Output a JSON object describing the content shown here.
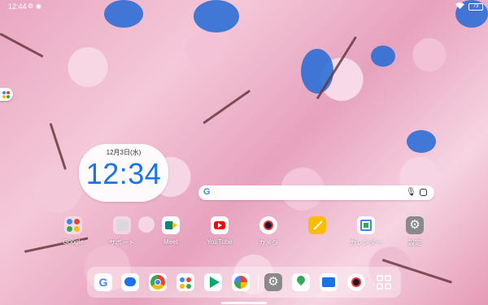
{
  "status_bar": {
    "time": "12:44",
    "battery": "73",
    "icons": [
      "gear-icon",
      "location-icon",
      "wifi-icon",
      "battery-icon"
    ]
  },
  "clock_widget": {
    "date": "12月3日(水)",
    "time": "12:34"
  },
  "search_bar": {
    "logo": "G",
    "icons": [
      "google-logo-icon",
      "microphone-icon",
      "google-lens-icon"
    ]
  },
  "home_apps": [
    {
      "label": "Google",
      "icon": "google-folder-icon"
    },
    {
      "label": "サポート",
      "icon": "support-folder-icon"
    },
    {
      "label": "",
      "icon": "unlabeled-app-icon"
    },
    {
      "label": "Meet",
      "icon": "meet-icon"
    },
    {
      "label": "YouTube",
      "icon": "youtube-icon"
    },
    {
      "label": "カメラ",
      "icon": "camera-icon"
    },
    {
      "label": "",
      "icon": "notes-icon"
    },
    {
      "label": "カレンダー",
      "icon": "calendar-icon"
    },
    {
      "label": "設定",
      "icon": "settings-icon"
    }
  ],
  "dock": [
    "google-icon",
    "messages-icon",
    "chrome-icon",
    "assistant-icon",
    "play-store-icon",
    "photos-icon",
    "settings-icon",
    "maps-icon",
    "files-icon",
    "camera-icon",
    "all-apps-icon"
  ],
  "colors": {
    "accent": "#1a73e8",
    "sky": "#2d6fd6",
    "blossom": "#f4c8d9"
  }
}
